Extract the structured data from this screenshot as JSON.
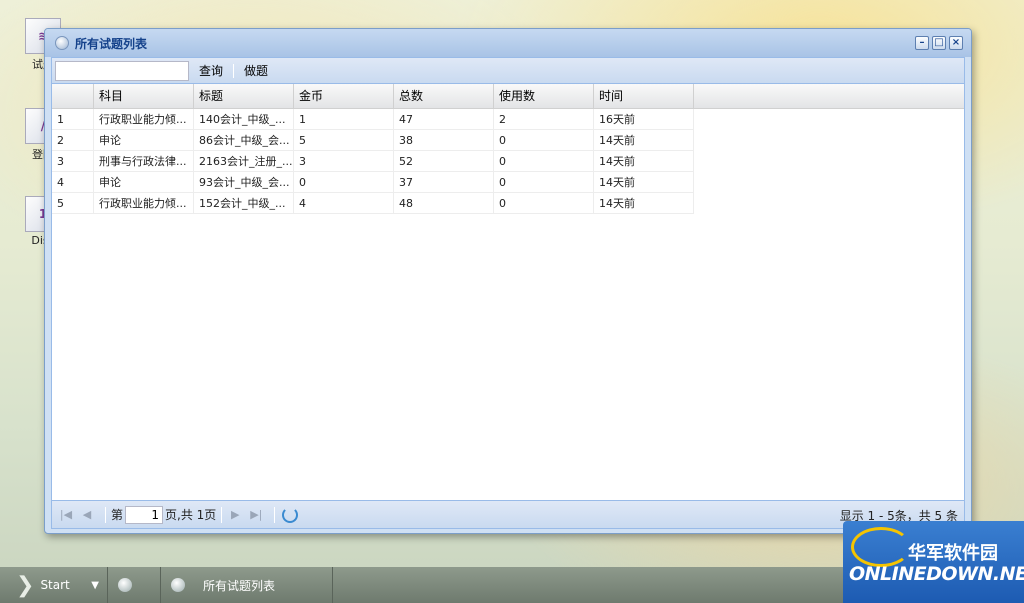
{
  "desktop": {
    "icons": [
      {
        "label": "试题"
      },
      {
        "label": "登陆"
      },
      {
        "label": "Disc"
      }
    ]
  },
  "window": {
    "title": "所有试题列表",
    "controls": {
      "minimize": "–",
      "maximize": "□",
      "close": "×"
    }
  },
  "toolbar": {
    "search_value": "",
    "search_placeholder": "",
    "query_label": "查询",
    "practice_label": "做题"
  },
  "table": {
    "columns": [
      "",
      "科目",
      "标题",
      "金币",
      "总数",
      "使用数",
      "时间"
    ],
    "rows": [
      [
        "1",
        "行政职业能力倾...",
        "140会计_中级_...",
        "1",
        "47",
        "2",
        "16天前"
      ],
      [
        "2",
        "申论",
        "86会计_中级_会...",
        "5",
        "38",
        "0",
        "14天前"
      ],
      [
        "3",
        "刑事与行政法律...",
        "2163会计_注册_...",
        "3",
        "52",
        "0",
        "14天前"
      ],
      [
        "4",
        "申论",
        "93会计_中级_会...",
        "0",
        "37",
        "0",
        "14天前"
      ],
      [
        "5",
        "行政职业能力倾...",
        "152会计_中级_...",
        "4",
        "48",
        "0",
        "14天前"
      ]
    ]
  },
  "pager": {
    "page_prefix": "第",
    "page_value": "1",
    "page_suffix": "页,共 1页",
    "info": "显示 1 - 5条，共 5 条"
  },
  "taskbar": {
    "start_label": "Start",
    "active_task": "所有试题列表"
  },
  "watermark": {
    "cn": "华军软件园",
    "en": "ONLINEDOWN.NET"
  }
}
